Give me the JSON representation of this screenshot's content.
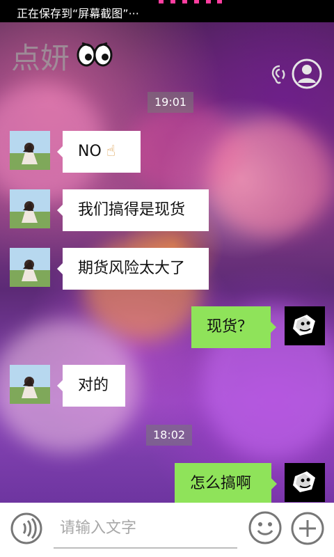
{
  "status": {
    "text": "正在保存到“屏幕截图”···"
  },
  "header": {
    "contact_name": "点妍",
    "eyes_icon": "eyes-icon",
    "ear_icon": "ear-icon",
    "profile_icon": "profile-icon"
  },
  "timestamps": [
    "19:01",
    "18:02"
  ],
  "messages": [
    {
      "side": "left",
      "text": "NO",
      "emoji": "☝"
    },
    {
      "side": "left",
      "text": "我们搞得是现货"
    },
    {
      "side": "left",
      "text": "期货风险太大了"
    },
    {
      "side": "right",
      "text": "现货？"
    },
    {
      "side": "left",
      "text": "对的"
    },
    {
      "side": "right",
      "text": "怎么搞啊"
    }
  ],
  "composer": {
    "placeholder": "请输入文字",
    "voice_icon": "voice-icon",
    "emoji_icon": "smile-icon",
    "plus_icon": "plus-icon"
  },
  "colors": {
    "right_bubble": "#8fe35a",
    "left_bubble": "#ffffff",
    "status_accent": "#ff3ea0"
  }
}
